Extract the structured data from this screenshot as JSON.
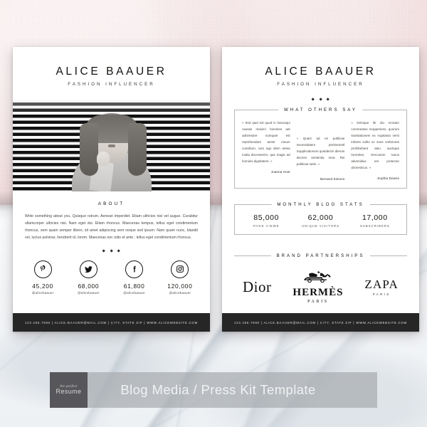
{
  "background": {
    "top_color": "#f0dcdd",
    "bottom_color": "#f3f5f7"
  },
  "left_page": {
    "brand_name": "ALICE BAAUER",
    "brand_subtitle": "FASHION INFLUENCER",
    "photo": {
      "alt": "portrait-photo",
      "style": "black-and-white striped backdrop"
    },
    "about": {
      "title": "ABOUT",
      "body": "Write something about you. Quisque rutrum. Aenean imperdiet. Etiam ultricies nisi vel augue. Curabitur ullamcorper ultricies nisi. Nam eget dui. Etiam rhoncus. Maecenas tempus, tellus eget condimentum rhoncus, sem quam semper libero, sit amet adipiscing sem neque sed ipsum. Nam quam nunc, blandit vel, luctus pulvinar, hendrerit id, lorem. Maecenas nec odio et ante ; tellus eget condimentum rhoncus."
    },
    "socials": [
      {
        "icon": "pinterest-icon",
        "network": "Pinterest",
        "count": "45,200",
        "handle": "@alicebaauer"
      },
      {
        "icon": "twitter-icon",
        "network": "Twitter",
        "count": "68,000",
        "handle": "@alicebaauer"
      },
      {
        "icon": "facebook-icon",
        "network": "Facebook",
        "count": "61,800",
        "handle": "@alicebaauer"
      },
      {
        "icon": "instagram-icon",
        "network": "Instagram",
        "count": "120,000",
        "handle": "@alicebaauer"
      }
    ],
    "footer": "123.456.7890  |  ALICE.BAAUER@MAIL.COM  |  CITY, STATE ZIP  |  WWW.ALICEWEBSITE.COM"
  },
  "right_page": {
    "brand_name": "ALICE BAAUER",
    "brand_subtitle": "FASHION INFLUENCER",
    "testimonials": {
      "title": "WHAT OTHERS SAY",
      "items": [
        {
          "text": "« Sed quid est quod in hacusqui causas maximi homines aet adniretutre sumquet est reprehendant aeste meum consilium, cum ego idem antea multa decrewerim, que magis ad hominis dignitatem. »",
          "author": "Joanna Host"
        },
        {
          "text": "« Quam ad rei publicae necessitatem pertinerentl Supplicationem quindecim dierum decrevi sententia mea. Rei publicae satis. »",
          "author": "Bernard Simons"
        },
        {
          "text": "« Demque ibi diu moratur commeatus reopperiens, quorum translationem ex Aquitania versi imbres solito ec suns crebriores prohibebant ateu aucitque torrentes, Hercosem lanus adveniitius est protector domesticus. »",
          "author": "Sophia Downs"
        }
      ]
    },
    "blog_stats": {
      "title": "MONTHLY BLOG STATS",
      "items": [
        {
          "value": "85,000",
          "label": "PAGE VIEWS"
        },
        {
          "value": "62,000",
          "label": "UNIQUE VISITORS"
        },
        {
          "value": "17,000",
          "label": "SUBSCRIBERS"
        }
      ]
    },
    "brand_partnerships": {
      "title": "BRAND PARTNERSHIPS",
      "brands": [
        {
          "name": "Dior",
          "sub": ""
        },
        {
          "name": "HERMÈS",
          "sub": "PARIS"
        },
        {
          "name": "ZAPA",
          "sub": "PARIS"
        }
      ]
    },
    "footer": "123.456.7890  |  ALICE.BAAUER@MAIL.COM  |  CITY, STATE ZIP  |  WWW.ALICEWEBSITE.COM"
  },
  "banner": {
    "badge_script": "the perfect",
    "badge_word": "Resume",
    "title": "Blog Media / Press Kit Template"
  }
}
